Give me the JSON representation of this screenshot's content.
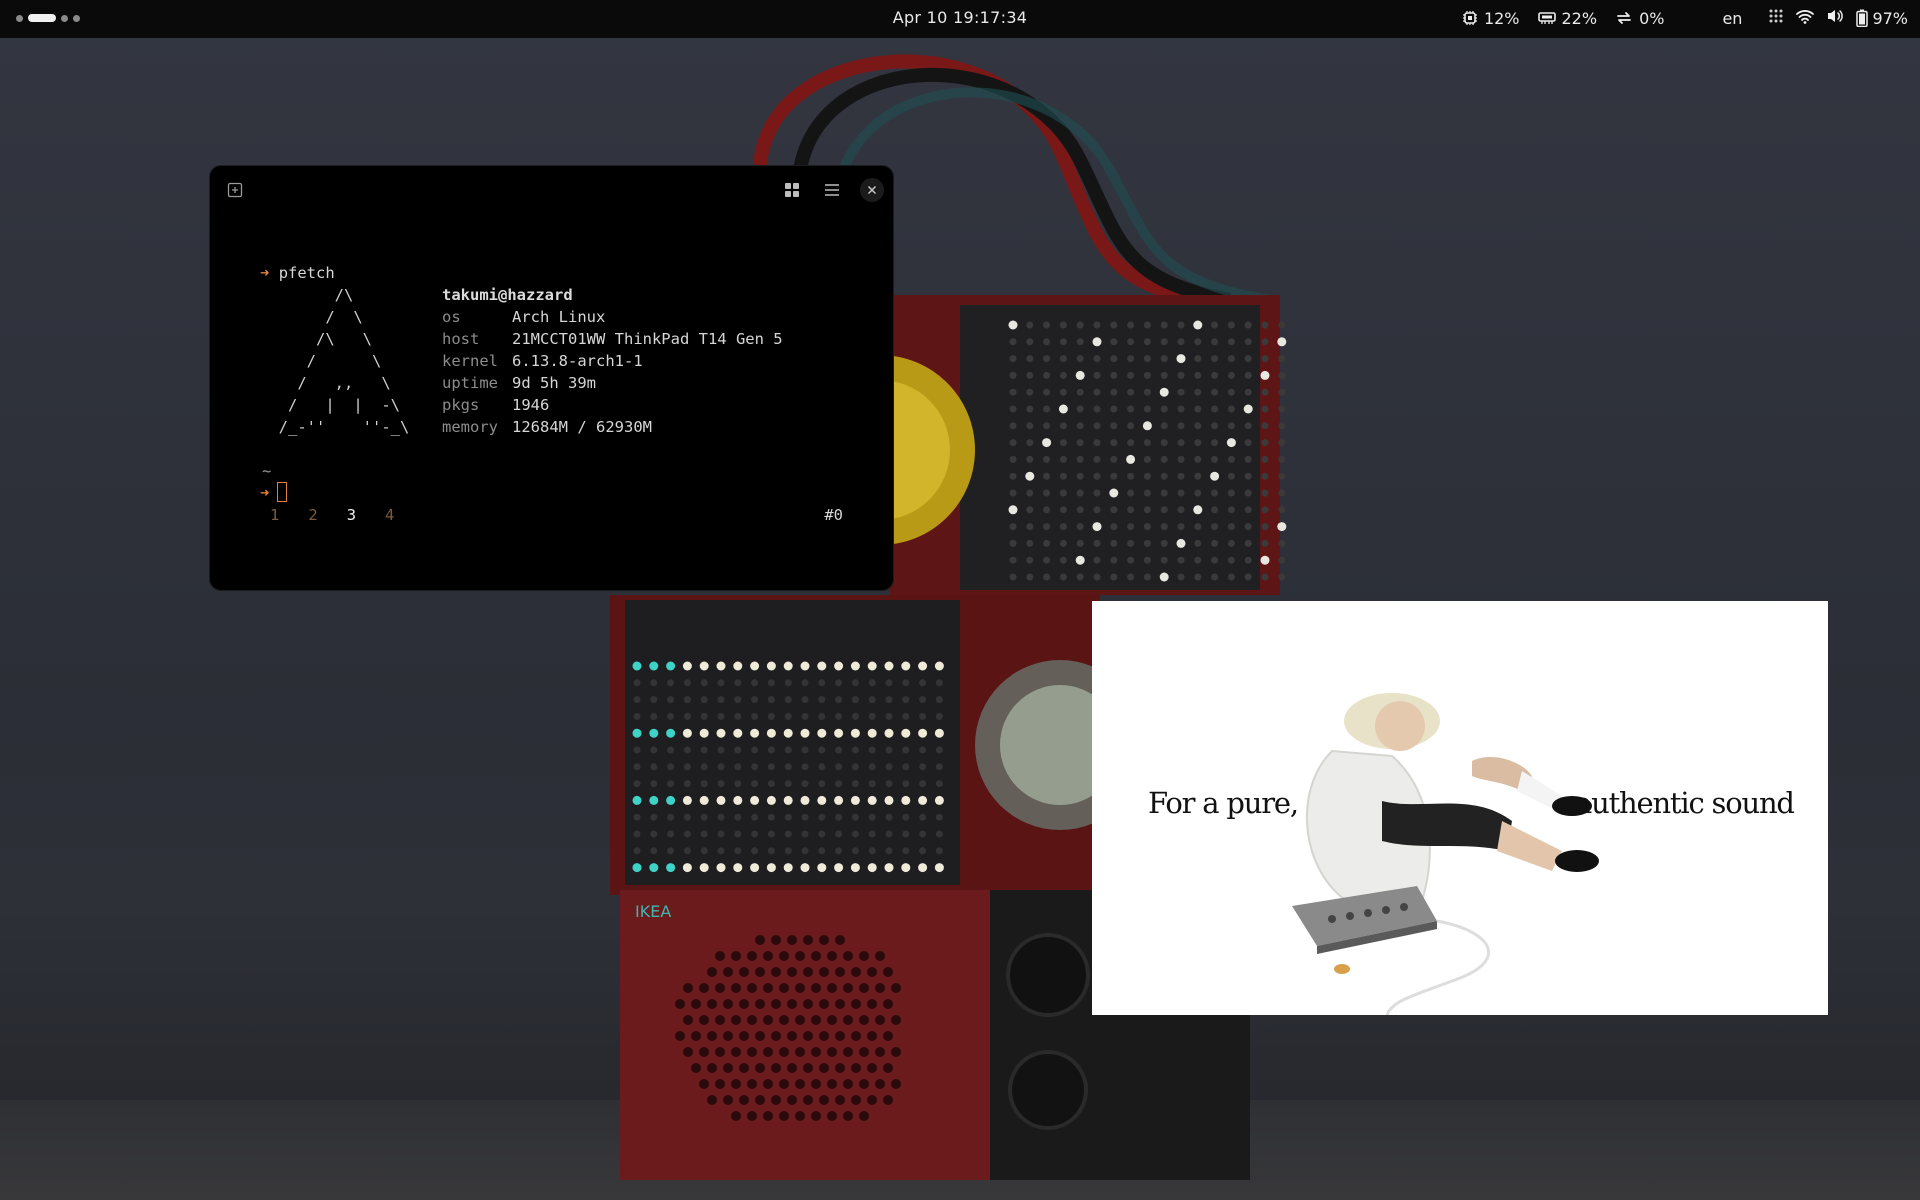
{
  "topbar": {
    "clock": "Apr 10 19:17:34",
    "cpu": "12%",
    "ram": "22%",
    "swap": "0%",
    "lang": "en",
    "battery": "97%",
    "workspaces": 4,
    "active_workspace": 2
  },
  "terminal": {
    "command": "pfetch",
    "logo": [
      "        /\\",
      "       /  \\",
      "      /\\   \\",
      "     /      \\",
      "    /   ,,   \\",
      "   /   |  |  -\\",
      "  /_-''    ''-_\\"
    ],
    "user": "takumi@hazzard",
    "info": [
      {
        "key": "os",
        "value": "Arch Linux"
      },
      {
        "key": "host",
        "value": "21MCCT01WW ThinkPad T14 Gen 5"
      },
      {
        "key": "kernel",
        "value": "6.13.8-arch1-1"
      },
      {
        "key": "uptime",
        "value": "9d 5h 39m"
      },
      {
        "key": "pkgs",
        "value": "1946"
      },
      {
        "key": "memory",
        "value": "12684M / 62930M"
      }
    ],
    "cwd": "~",
    "tabs": [
      "1",
      "2",
      "3",
      "4"
    ],
    "active_tab": "3",
    "session": "#0"
  },
  "ad": {
    "left_text": "For a pure,",
    "right_text": "authentic sound"
  },
  "wallpaper": {
    "brand": "IKEA"
  },
  "colors": {
    "prompt_arrow": "#e0823d",
    "tab_inactive": "#7a5b3e",
    "speaker_red": "#7a1f1f",
    "led_cyan": "#3fd3c8"
  },
  "icons": {
    "cpu": "cpu-icon",
    "ram": "memory-icon",
    "swap": "swap-arrows-icon",
    "apps": "grid-dots-icon",
    "wifi": "wifi-icon",
    "volume": "speaker-icon",
    "battery": "battery-icon",
    "new_tab": "plus-square-icon",
    "layout": "grid-icon",
    "menu": "hamburger-icon",
    "close": "close-icon"
  }
}
